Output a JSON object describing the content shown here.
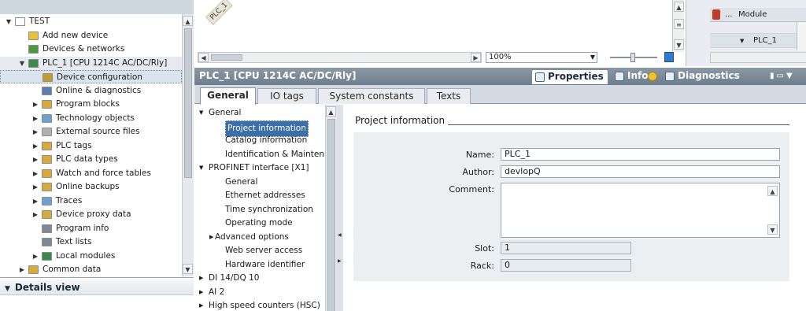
{
  "project_tree": {
    "items": [
      {
        "label": "TEST",
        "icon": "project-icon",
        "color": "#ffffff",
        "level": 0,
        "expander": "▼"
      },
      {
        "label": "Add new device",
        "icon": "add-device-icon",
        "color": "#e6c23a",
        "level": 1,
        "expander": ""
      },
      {
        "label": "Devices & networks",
        "icon": "network-icon",
        "color": "#4d9a3a",
        "level": 1,
        "expander": ""
      },
      {
        "label": "PLC_1 [CPU 1214C AC/DC/Rly]",
        "icon": "plc-icon",
        "color": "#3c8a4a",
        "level": 1,
        "expander": "▼"
      },
      {
        "label": "Device configuration",
        "icon": "device-config-icon",
        "color": "#c49a2a",
        "level": 2,
        "expander": ""
      },
      {
        "label": "Online & diagnostics",
        "icon": "diagnostics-icon",
        "color": "#5a7fb0",
        "level": 2,
        "expander": ""
      },
      {
        "label": "Program blocks",
        "icon": "folder-icon",
        "color": "#d9a93a",
        "level": 2,
        "expander": "▶"
      },
      {
        "label": "Technology objects",
        "icon": "folder-icon",
        "color": "#6fa0d0",
        "level": 2,
        "expander": "▶"
      },
      {
        "label": "External source files",
        "icon": "folder-icon",
        "color": "#b0b0b0",
        "level": 2,
        "expander": "▶"
      },
      {
        "label": "PLC tags",
        "icon": "folder-icon",
        "color": "#d9a93a",
        "level": 2,
        "expander": "▶"
      },
      {
        "label": "PLC data types",
        "icon": "folder-icon",
        "color": "#d9a93a",
        "level": 2,
        "expander": "▶"
      },
      {
        "label": "Watch and force tables",
        "icon": "folder-icon",
        "color": "#d9a93a",
        "level": 2,
        "expander": "▶"
      },
      {
        "label": "Online backups",
        "icon": "folder-icon",
        "color": "#d9a93a",
        "level": 2,
        "expander": "▶"
      },
      {
        "label": "Traces",
        "icon": "folder-icon",
        "color": "#6fa0d0",
        "level": 2,
        "expander": "▶"
      },
      {
        "label": "Device proxy data",
        "icon": "folder-icon",
        "color": "#d9a93a",
        "level": 2,
        "expander": "▶"
      },
      {
        "label": "Program info",
        "icon": "program-info-icon",
        "color": "#7d8a96",
        "level": 2,
        "expander": ""
      },
      {
        "label": "Text lists",
        "icon": "text-list-icon",
        "color": "#7d8a96",
        "level": 2,
        "expander": ""
      },
      {
        "label": "Local modules",
        "icon": "folder-icon",
        "color": "#3c8a4a",
        "level": 2,
        "expander": "▶"
      },
      {
        "label": "Common data",
        "icon": "folder-icon",
        "color": "#d9a93a",
        "level": 1,
        "expander": "▶"
      }
    ]
  },
  "details_view": {
    "label": "Details view"
  },
  "device_view": {
    "plc_label": "PLC_1",
    "zoom": "100%"
  },
  "overview": {
    "column": "Module",
    "ellipsis": "...",
    "row_label": "PLC_1"
  },
  "inspector": {
    "title": "PLC_1 [CPU 1214C AC/DC/Rly]",
    "tabs": [
      {
        "label": "Properties",
        "icon": "properties-icon",
        "active": true
      },
      {
        "label": "Info",
        "icon": "info-icon",
        "active": false
      },
      {
        "label": "Diagnostics",
        "icon": "diagnostics-icon",
        "active": false
      }
    ],
    "sub_tabs": [
      {
        "label": "General",
        "active": true
      },
      {
        "label": "IO tags",
        "active": false
      },
      {
        "label": "System constants",
        "active": false
      },
      {
        "label": "Texts",
        "active": false
      }
    ],
    "nav": [
      {
        "label": "General",
        "indent": 0,
        "expander": "▼",
        "selected": false
      },
      {
        "label": "Project information",
        "indent": 2,
        "expander": "",
        "selected": true
      },
      {
        "label": "Catalog information",
        "indent": 2,
        "expander": "",
        "selected": false
      },
      {
        "label": "Identification & Mainten...",
        "indent": 2,
        "expander": "",
        "selected": false
      },
      {
        "label": "PROFINET interface [X1]",
        "indent": 0,
        "expander": "▼",
        "selected": false
      },
      {
        "label": "General",
        "indent": 2,
        "expander": "",
        "selected": false
      },
      {
        "label": "Ethernet addresses",
        "indent": 2,
        "expander": "",
        "selected": false
      },
      {
        "label": "Time synchronization",
        "indent": 2,
        "expander": "",
        "selected": false
      },
      {
        "label": "Operating mode",
        "indent": 2,
        "expander": "",
        "selected": false
      },
      {
        "label": "Advanced options",
        "indent": 1,
        "expander": "▶",
        "selected": false
      },
      {
        "label": "Web server access",
        "indent": 2,
        "expander": "",
        "selected": false
      },
      {
        "label": "Hardware identifier",
        "indent": 2,
        "expander": "",
        "selected": false
      },
      {
        "label": "DI 14/DQ 10",
        "indent": 0,
        "expander": "▶",
        "selected": false
      },
      {
        "label": "AI 2",
        "indent": 0,
        "expander": "▶",
        "selected": false
      },
      {
        "label": "High speed counters (HSC)",
        "indent": 0,
        "expander": "▶",
        "selected": false
      }
    ]
  },
  "project_info": {
    "section_title": "Project information",
    "name_label": "Name:",
    "name_value": "PLC_1",
    "author_label": "Author:",
    "author_value": "devlopQ",
    "comment_label": "Comment:",
    "comment_value": "",
    "slot_label": "Slot:",
    "slot_value": "1",
    "rack_label": "Rack:",
    "rack_value": "0"
  },
  "colors": {
    "selection": "#3c6ea8",
    "inspector_title": "#7d8b98",
    "form_background": "#eceff2"
  }
}
